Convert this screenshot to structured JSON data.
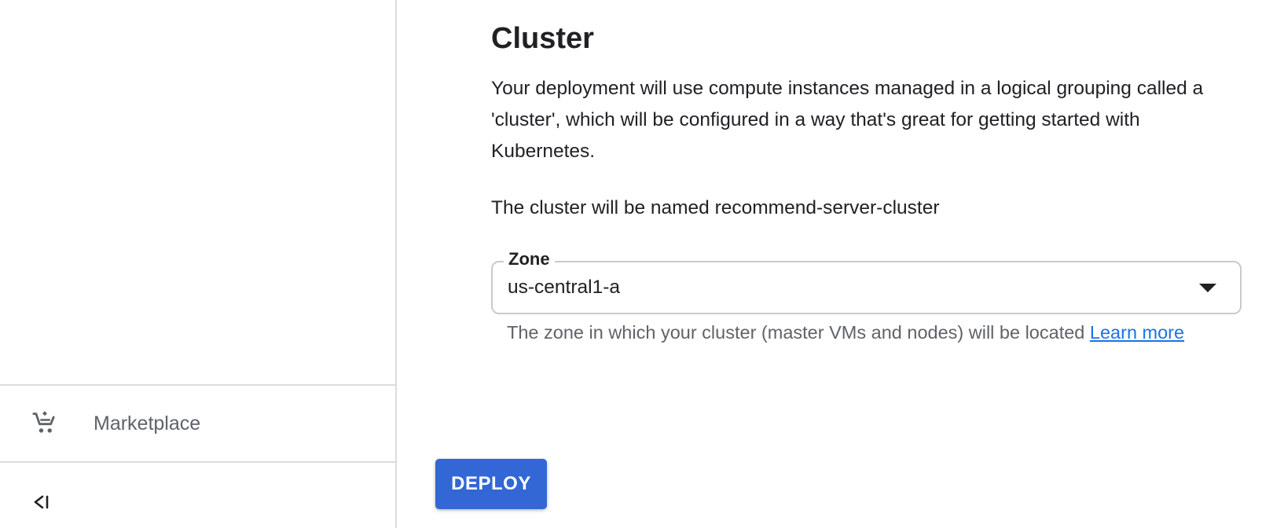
{
  "sidebar": {
    "items": [
      {
        "label": "Marketplace",
        "icon": "marketplace-cart-icon"
      }
    ],
    "collapse_icon": "collapse-sidebar-icon"
  },
  "main": {
    "section_title": "Cluster",
    "description": "Your deployment will use compute instances managed in a logical grouping called a 'cluster', which will be configured in a way that's great for getting started with Kubernetes.",
    "cluster_name_text": "The cluster will be named recommend-server-cluster",
    "zone": {
      "label": "Zone",
      "value": "us-central1-a",
      "helper_text": "The zone in which your cluster (master VMs and nodes) will be located",
      "learn_more": "Learn more"
    },
    "deploy_label": "DEPLOY"
  },
  "colors": {
    "accent": "#3367d6",
    "link": "#1a73e8",
    "divider": "#dadce0",
    "text_primary": "#202124",
    "text_secondary": "#5f6368"
  }
}
